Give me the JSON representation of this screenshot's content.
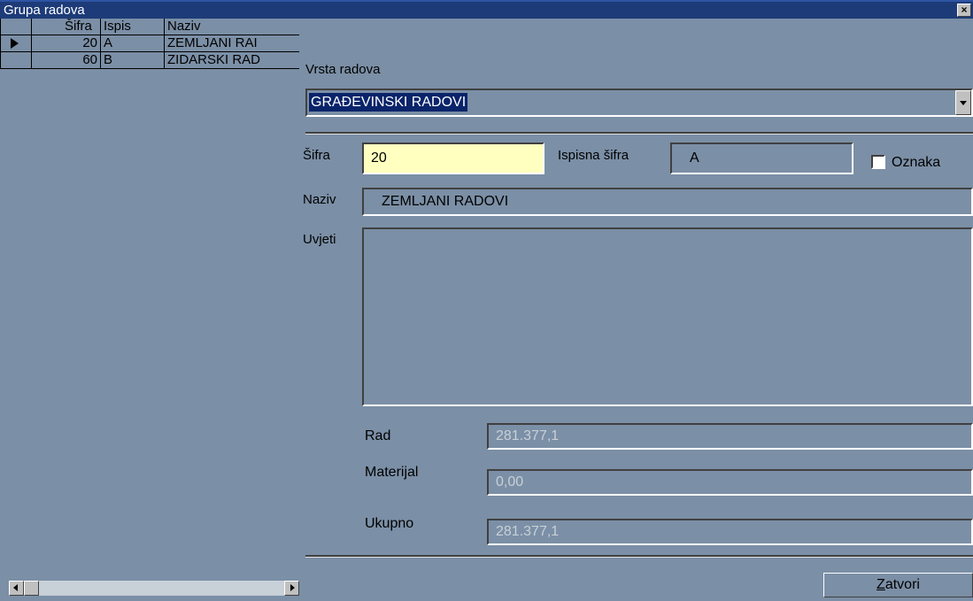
{
  "window": {
    "title": "Grupa radova",
    "close": "×"
  },
  "grid": {
    "headers": {
      "sifra": "Šifra",
      "ispis": "Ispis",
      "naziv": "Naziv"
    },
    "rows": [
      {
        "sifra": "20",
        "ispis": "A",
        "naziv": "ZEMLJANI RAI"
      },
      {
        "sifra": "60",
        "ispis": "B",
        "naziv": "ZIDARSKI RAD"
      }
    ]
  },
  "form": {
    "vrsta_label": "Vrsta radova",
    "vrsta_value": "GRAĐEVINSKI RADOVI",
    "sifra_label": "Šifra",
    "sifra_value": "20",
    "ispisna_label": "Ispisna šifra",
    "ispisna_value": "A",
    "oznaka_label": "Oznaka",
    "naziv_label": "Naziv",
    "naziv_value": "ZEMLJANI RADOVI",
    "uvjeti_label": "Uvjeti",
    "uvjeti_value": "",
    "rad_label": "Rad",
    "rad_value": "281.377,1",
    "materijal_label": "Materijal",
    "materijal_value": "0,00",
    "ukupno_label": "Ukupno",
    "ukupno_value": "281.377,1"
  },
  "buttons": {
    "zatvori_first": "Z",
    "zatvori_rest": "atvori"
  }
}
